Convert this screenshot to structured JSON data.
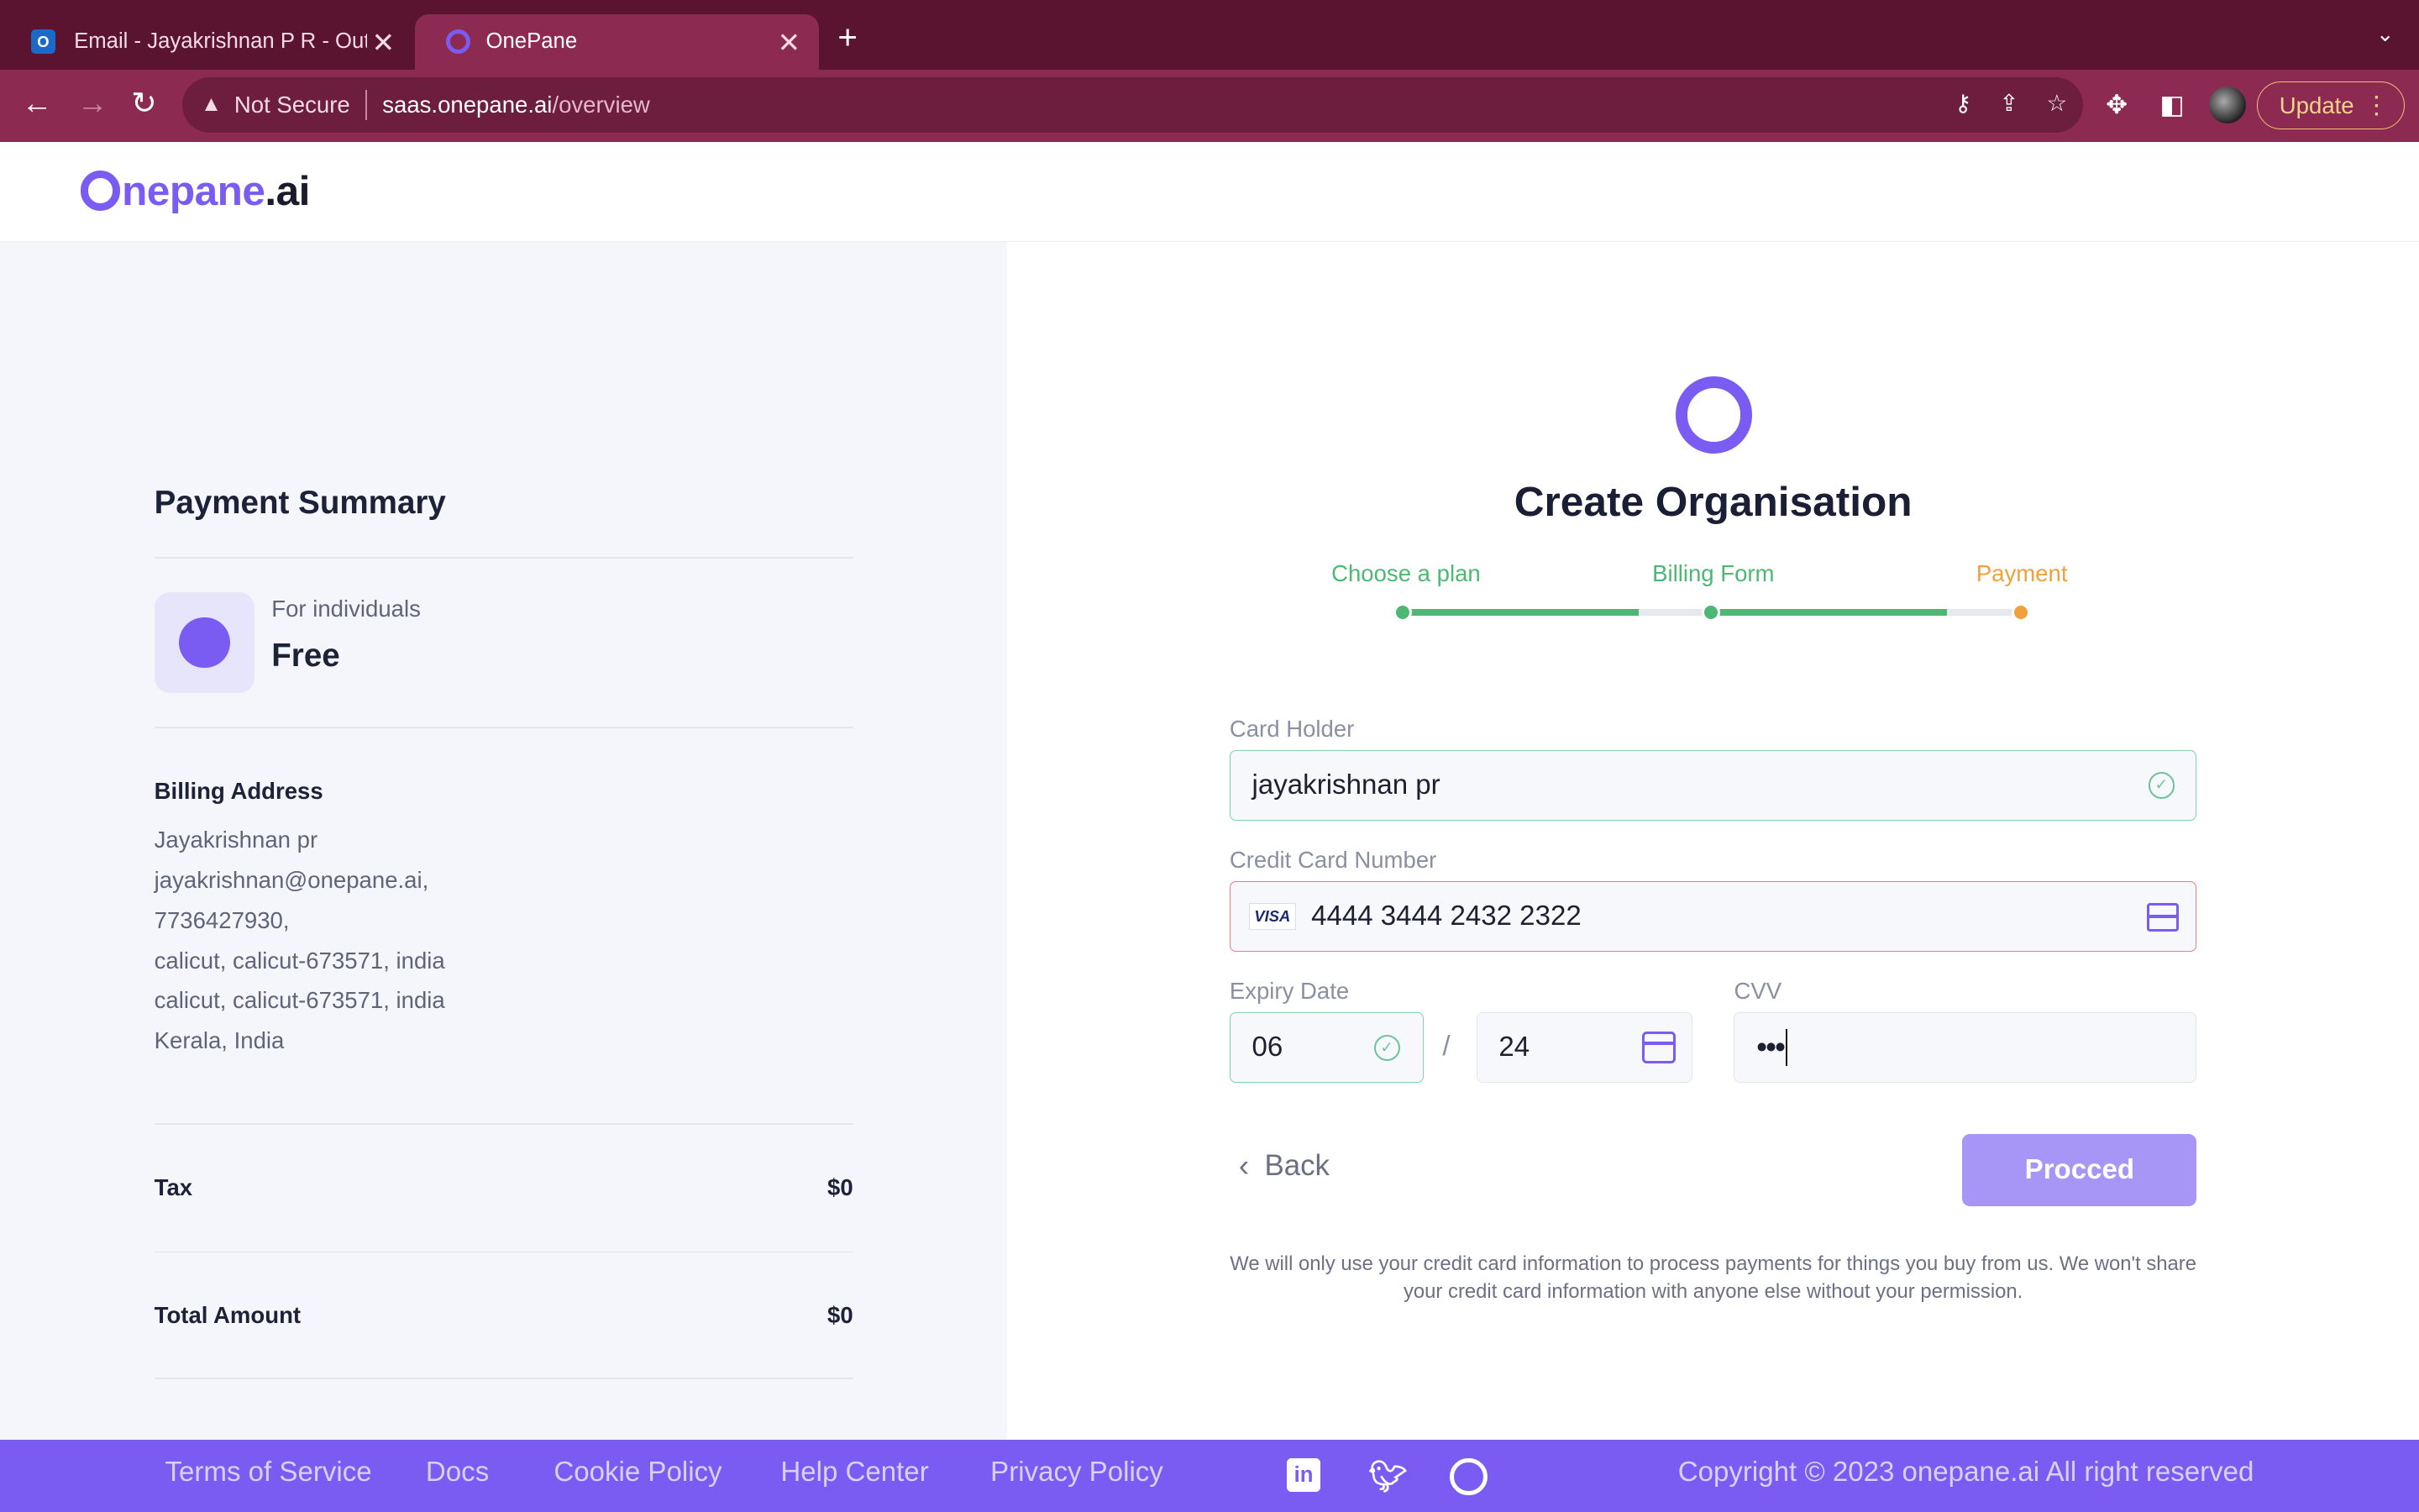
{
  "browser": {
    "tabs": [
      {
        "title": "Email - Jayakrishnan P R - Outl",
        "active": false
      },
      {
        "title": "OnePane",
        "active": true
      }
    ],
    "security_label": "Not Secure",
    "url_host": "saas.onepane.ai",
    "url_path": "/overview",
    "update_label": "Update"
  },
  "app": {
    "logo_mark": "O",
    "logo_brand": "nepane",
    "logo_tld": ".ai"
  },
  "summary": {
    "title": "Payment Summary",
    "plan_subtitle": "For individuals",
    "plan_name": "Free",
    "billing_title": "Billing Address",
    "billing_lines": [
      "Jayakrishnan pr",
      "jayakrishnan@onepane.ai,",
      "7736427930,",
      "calicut, calicut-673571, india",
      "calicut, calicut-673571, india",
      "Kerala, India"
    ],
    "tax_label": "Tax",
    "tax_value": "$0",
    "total_label": "Total Amount",
    "total_value": "$0"
  },
  "form": {
    "title": "Create Organisation",
    "steps": [
      {
        "label": "Choose a plan",
        "state": "done",
        "color": "#4cb873"
      },
      {
        "label": "Billing Form",
        "state": "done",
        "color": "#4cb873"
      },
      {
        "label": "Payment",
        "state": "current",
        "color": "#f0a13a"
      }
    ],
    "card_holder_label": "Card Holder",
    "card_holder_value": "jayakrishnan pr",
    "card_number_label": "Credit Card Number",
    "card_brand": "VISA",
    "card_number_value": "4444 3444 2432 2322",
    "expiry_label": "Expiry Date",
    "expiry_month": "06",
    "expiry_separator": "/",
    "expiry_year": "24",
    "cvv_label": "CVV",
    "cvv_value": "•••",
    "back_label": "Back",
    "proceed_label": "Procced",
    "notice": "We will only use your credit card information to process payments for things you buy from us. We won't share your credit card information with anyone else without your permission."
  },
  "footer": {
    "links": [
      "Terms of Service",
      "Docs",
      "Cookie Policy",
      "Help Center",
      "Privacy Policy"
    ],
    "copyright": "Copyright © 2023 onepane.ai All right reserved"
  },
  "colors": {
    "brand": "#7b5cf2",
    "chrome_dark": "#5b1430",
    "chrome": "#8d2a52",
    "success": "#4cb873",
    "warning": "#f0a13a",
    "error_border": "#f07c7c"
  }
}
